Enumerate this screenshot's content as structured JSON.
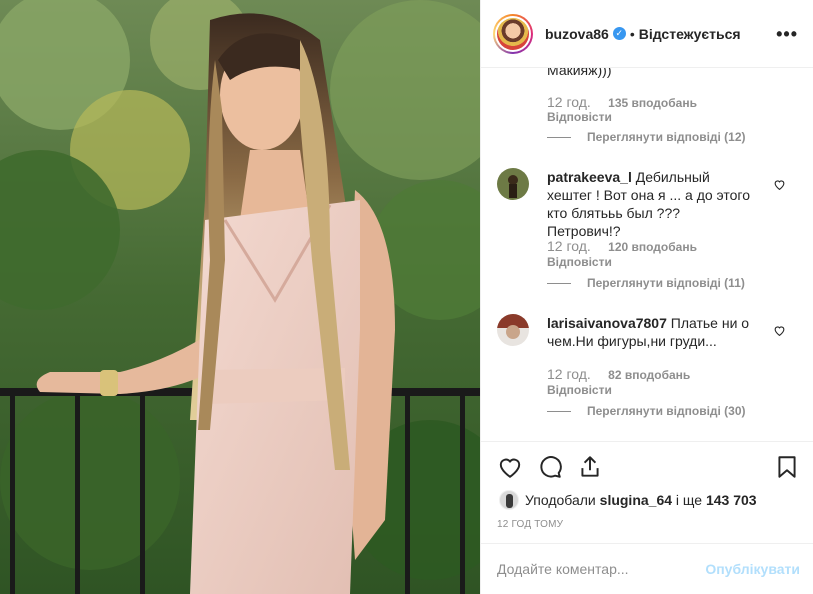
{
  "post": {
    "photo_alt": "Woman in pale pink dress standing by railing"
  },
  "header": {
    "username": "buzova86",
    "separator": "•",
    "follow_status": "Відстежується",
    "more_icon": "more-horizontal-icon"
  },
  "comments": {
    "cut_text": "Макияж)))",
    "first_meta": {
      "time": "12 год.",
      "likes": "135 вподобань",
      "reply": "Відповісти",
      "view_replies": "Переглянути відповіді (12)"
    },
    "items": [
      {
        "username": "patrakeeva_l",
        "text": "Дебильный хештег ! Вот она я ... а до этого кто блятььь был ??? Петрович!?",
        "time": "12 год.",
        "likes": "120 вподобань",
        "reply": "Відповісти",
        "view_replies": "Переглянути відповіді (11)"
      },
      {
        "username": "larisaivanova7807",
        "text": "Платье ни о чем.Ни фигуры,ни груди...",
        "time": "12 год.",
        "likes": "82 вподобань",
        "reply": "Відповісти",
        "view_replies": "Переглянути відповіді (30)"
      }
    ]
  },
  "actions": {
    "icons": [
      "heart-icon",
      "comment-icon",
      "share-icon",
      "bookmark-icon"
    ],
    "liked_prefix": "Уподобали",
    "liked_user": "slugina_64",
    "liked_mid": "і ще",
    "liked_count": "143 703",
    "timestamp": "12 ГОД ТОМУ"
  },
  "add_comment": {
    "placeholder": "Додайте коментар...",
    "publish_label": "Опублікувати"
  },
  "colors": {
    "verified": "#3897f0",
    "secondary_text": "#8e8e8e",
    "publish_disabled": "#b2dffc",
    "border": "#efefef"
  }
}
